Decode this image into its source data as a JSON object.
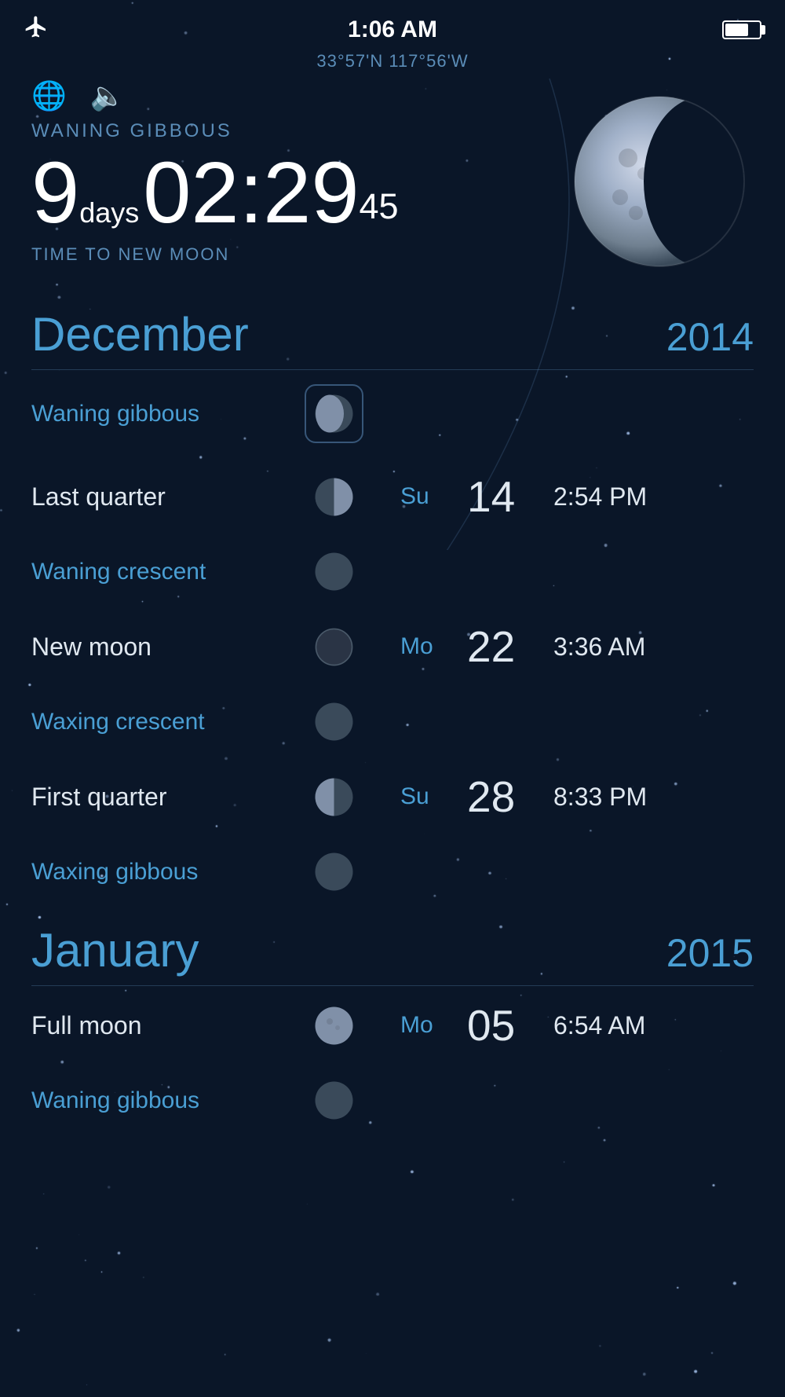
{
  "statusBar": {
    "time": "1:06 AM",
    "airplaneMode": true,
    "battery": 70
  },
  "location": {
    "coords": "33°57'N 117°56'W"
  },
  "currentPhase": {
    "label": "WANING GIBBOUS",
    "days": "9",
    "daysLabel": "days",
    "time": "02:29",
    "seconds": "45",
    "subtitle": "TIME TO NEW MOON"
  },
  "months": [
    {
      "name": "December",
      "year": "2014",
      "phases": [
        {
          "name": "Waning gibbous",
          "type": "minor",
          "icon": "waning-gibbous",
          "highlighted": true,
          "day": "",
          "dayLabel": "",
          "time": ""
        },
        {
          "name": "Last quarter",
          "type": "major",
          "icon": "last-quarter",
          "highlighted": false,
          "day": "14",
          "dayLabel": "Su",
          "time": "2:54 PM"
        },
        {
          "name": "Waning crescent",
          "type": "minor",
          "icon": "waning-crescent",
          "highlighted": false,
          "day": "",
          "dayLabel": "",
          "time": ""
        },
        {
          "name": "New moon",
          "type": "major",
          "icon": "new-moon",
          "highlighted": false,
          "day": "22",
          "dayLabel": "Mo",
          "time": "3:36 AM"
        },
        {
          "name": "Waxing crescent",
          "type": "minor",
          "icon": "waxing-crescent",
          "highlighted": false,
          "day": "",
          "dayLabel": "",
          "time": ""
        },
        {
          "name": "First quarter",
          "type": "major",
          "icon": "first-quarter",
          "highlighted": false,
          "day": "28",
          "dayLabel": "Su",
          "time": "8:33 PM"
        },
        {
          "name": "Waxing gibbous",
          "type": "minor",
          "icon": "waxing-gibbous",
          "highlighted": false,
          "day": "",
          "dayLabel": "",
          "time": ""
        }
      ]
    },
    {
      "name": "January",
      "year": "2015",
      "phases": [
        {
          "name": "Full moon",
          "type": "major",
          "icon": "full-moon",
          "highlighted": false,
          "day": "05",
          "dayLabel": "Mo",
          "time": "6:54 AM"
        },
        {
          "name": "Waning gibbous",
          "type": "minor",
          "icon": "waning-gibbous",
          "highlighted": false,
          "day": "",
          "dayLabel": "",
          "time": ""
        }
      ]
    }
  ]
}
